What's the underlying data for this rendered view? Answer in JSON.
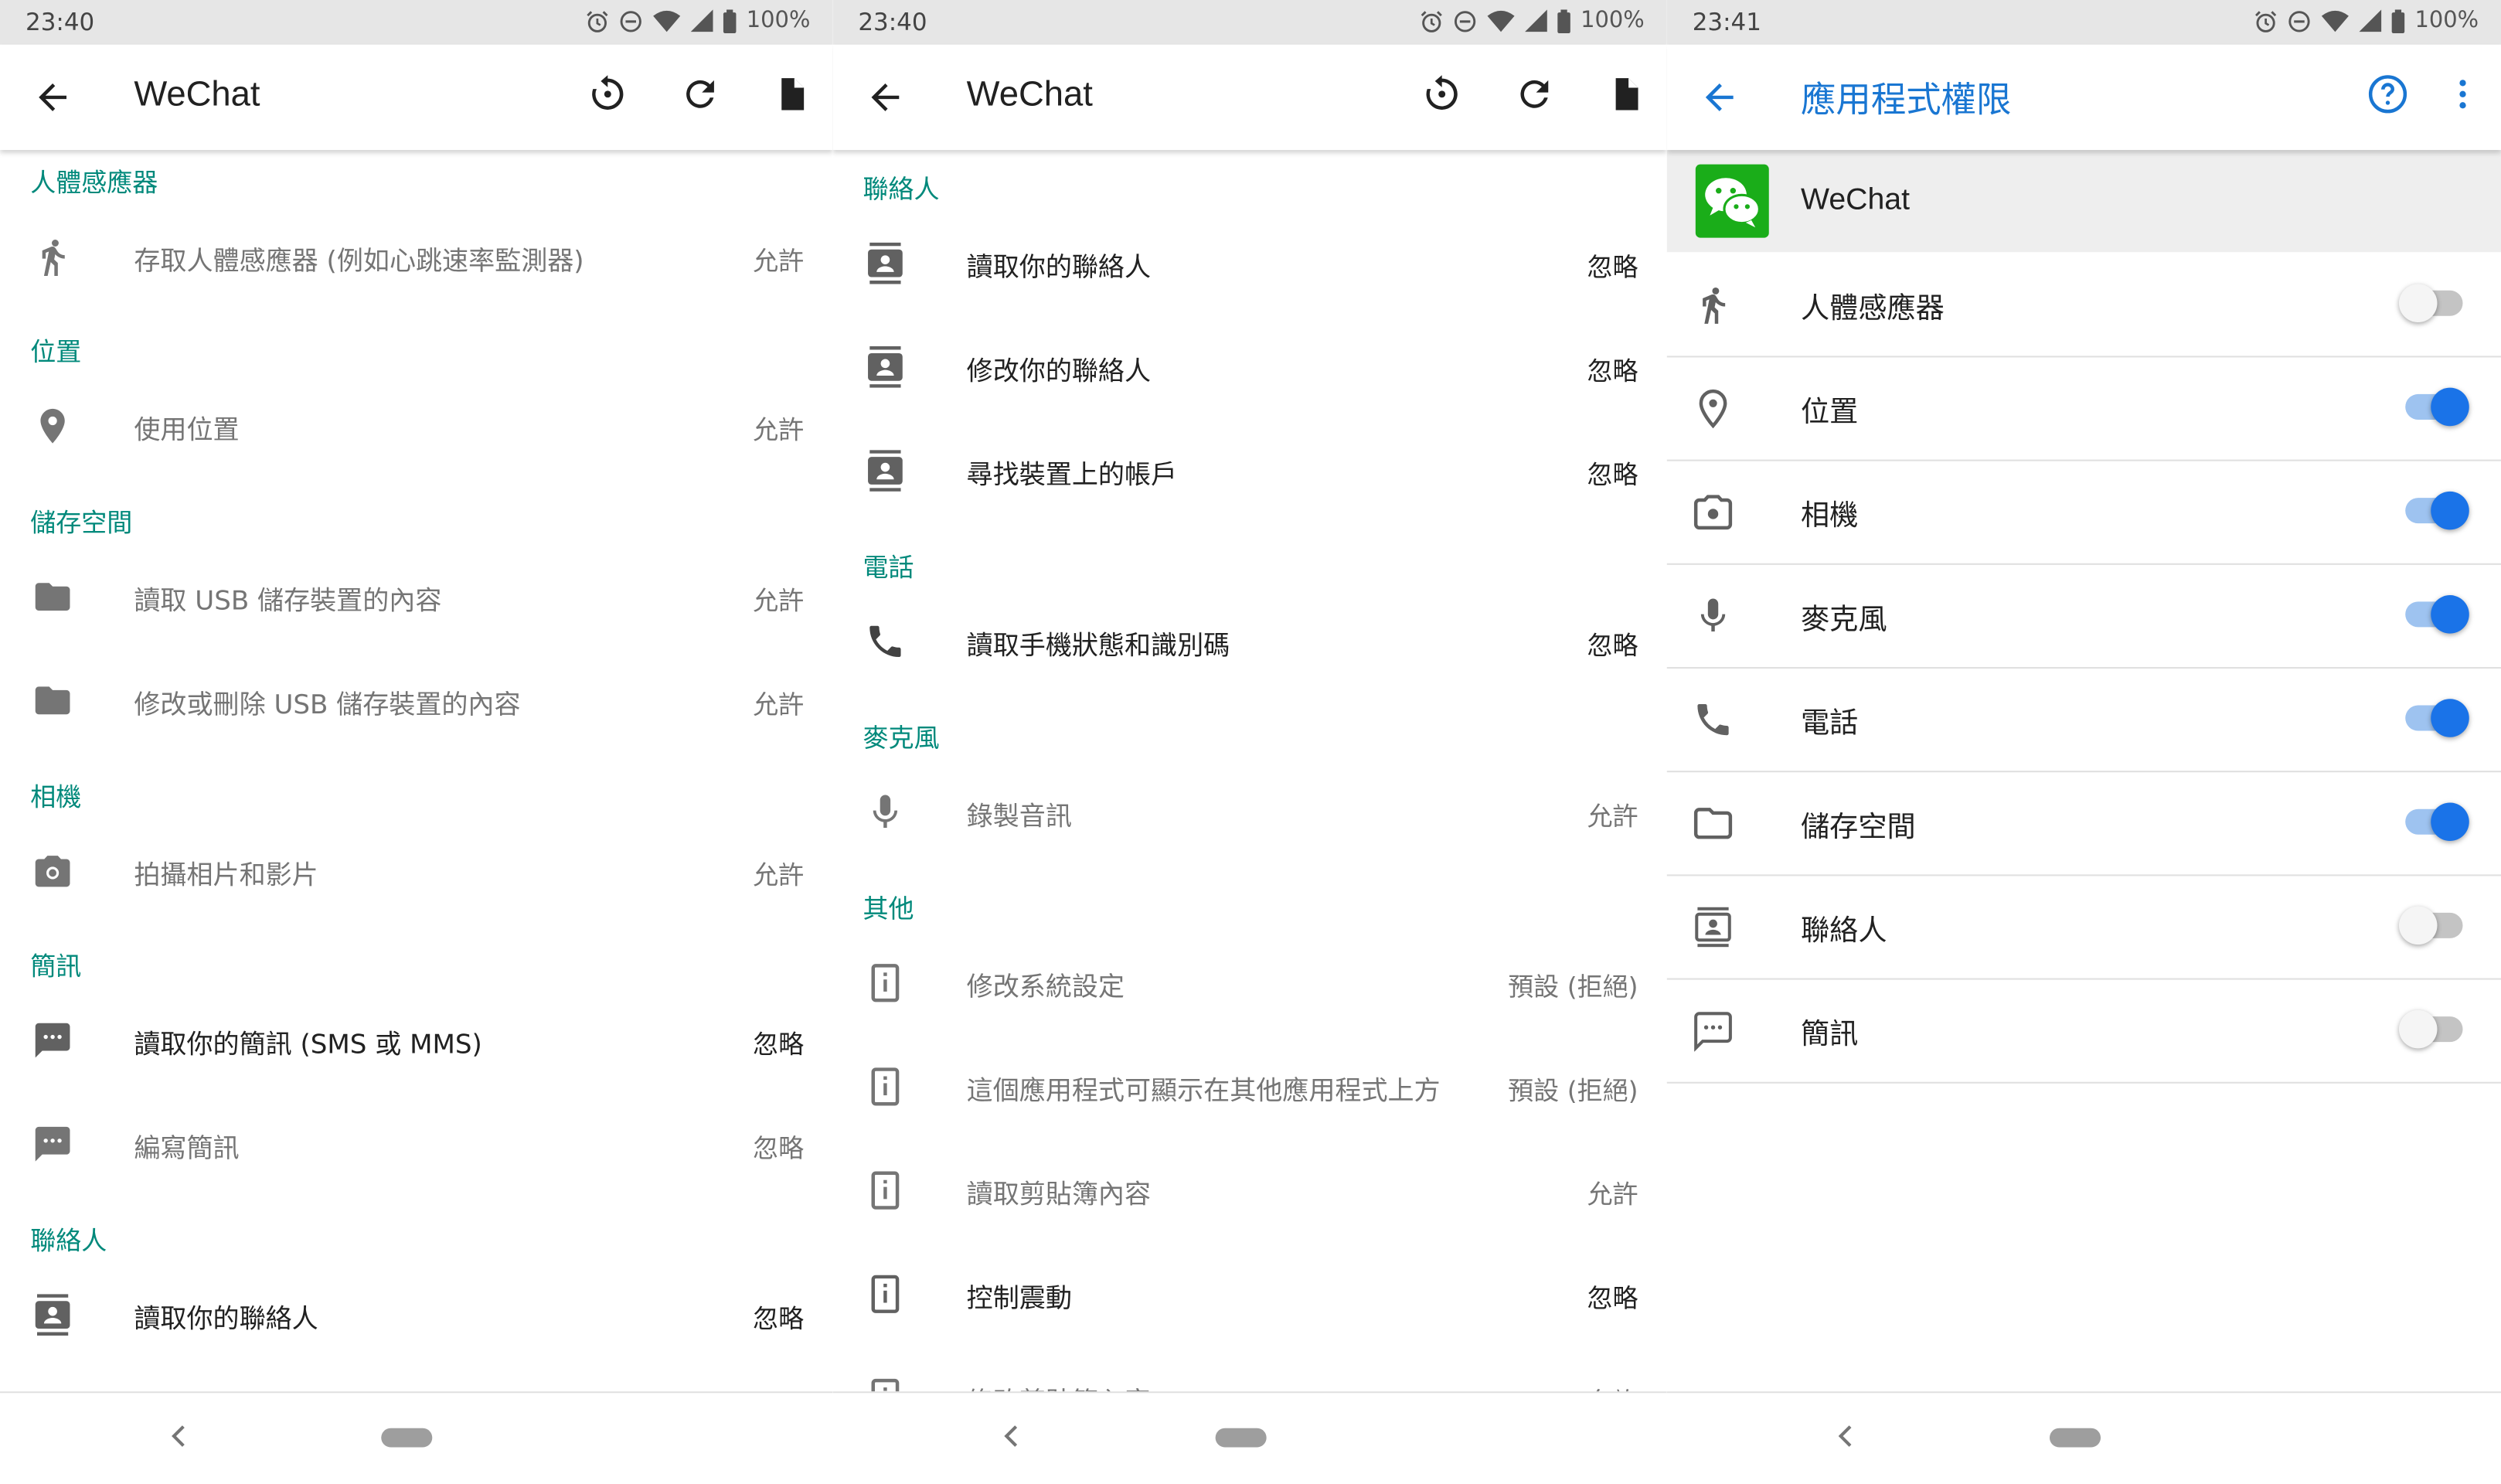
{
  "panel1": {
    "status_time": "23:40",
    "battery": "100%",
    "app_title": "WeChat",
    "sections": [
      {
        "header": "人體感應器",
        "rows": [
          {
            "label": "存取人體感應器 (例如心跳速率監測器)",
            "value": "允許",
            "icon": "run-icon"
          }
        ]
      },
      {
        "header": "位置",
        "rows": [
          {
            "label": "使用位置",
            "value": "允許",
            "icon": "location-icon"
          }
        ]
      },
      {
        "header": "儲存空間",
        "rows": [
          {
            "label": "讀取 USB 儲存裝置的內容",
            "value": "允許",
            "icon": "folder-icon"
          },
          {
            "label": "修改或刪除 USB 儲存裝置的內容",
            "value": "允許",
            "icon": "folder-icon"
          }
        ]
      },
      {
        "header": "相機",
        "rows": [
          {
            "label": "拍攝相片和影片",
            "value": "允許",
            "icon": "camera-icon"
          }
        ]
      },
      {
        "header": "簡訊",
        "rows": [
          {
            "label": "讀取你的簡訊 (SMS 或 MMS)",
            "value": "忽略",
            "icon": "message-icon"
          },
          {
            "label": "編寫簡訊",
            "value": "忽略",
            "icon": "message-icon"
          }
        ]
      },
      {
        "header": "聯絡人",
        "rows": [
          {
            "label": "讀取你的聯絡人",
            "value": "忽略",
            "icon": "contacts-icon"
          }
        ]
      }
    ]
  },
  "panel2": {
    "status_time": "23:40",
    "battery": "100%",
    "app_title": "WeChat",
    "sections": [
      {
        "header": "聯絡人",
        "rows": [
          {
            "label": "讀取你的聯絡人",
            "value": "忽略",
            "icon": "contacts-icon"
          },
          {
            "label": "修改你的聯絡人",
            "value": "忽略",
            "icon": "contacts-icon"
          },
          {
            "label": "尋找裝置上的帳戶",
            "value": "忽略",
            "icon": "contacts-icon"
          }
        ]
      },
      {
        "header": "電話",
        "rows": [
          {
            "label": "讀取手機狀態和識別碼",
            "value": "忽略",
            "icon": "phone-icon"
          }
        ]
      },
      {
        "header": "麥克風",
        "rows": [
          {
            "label": "錄製音訊",
            "value": "允許",
            "icon": "mic-icon"
          }
        ]
      },
      {
        "header": "其他",
        "rows": [
          {
            "label": "修改系統設定",
            "value": "預設 (拒絕)",
            "icon": "info-icon"
          },
          {
            "label": "這個應用程式可顯示在其他應用程式上方",
            "value": "預設 (拒絕)",
            "icon": "info-icon"
          },
          {
            "label": "讀取剪貼簿內容",
            "value": "允許",
            "icon": "info-icon"
          },
          {
            "label": "控制震動",
            "value": "忽略",
            "icon": "info-icon"
          },
          {
            "label": "修改剪貼簿內容",
            "value": "允許",
            "icon": "info-icon"
          }
        ]
      }
    ]
  },
  "panel3": {
    "status_time": "23:41",
    "battery": "100%",
    "title": "應用程式權限",
    "app_name": "WeChat",
    "permissions": [
      {
        "label": "人體感應器",
        "enabled": false,
        "icon": "run-icon"
      },
      {
        "label": "位置",
        "enabled": true,
        "icon": "location-outline-icon"
      },
      {
        "label": "相機",
        "enabled": true,
        "icon": "camera-icon"
      },
      {
        "label": "麥克風",
        "enabled": true,
        "icon": "mic-icon"
      },
      {
        "label": "電話",
        "enabled": true,
        "icon": "phone-icon"
      },
      {
        "label": "儲存空間",
        "enabled": true,
        "icon": "folder-outline-icon"
      },
      {
        "label": "聯絡人",
        "enabled": false,
        "icon": "contacts-icon"
      },
      {
        "label": "簡訊",
        "enabled": false,
        "icon": "message-outline-icon"
      }
    ]
  },
  "colors": {
    "accent_teal": "#00897b",
    "accent_blue": "#1976d2",
    "toggle_on": "#1a73e8",
    "wechat_green": "#1aad19"
  }
}
